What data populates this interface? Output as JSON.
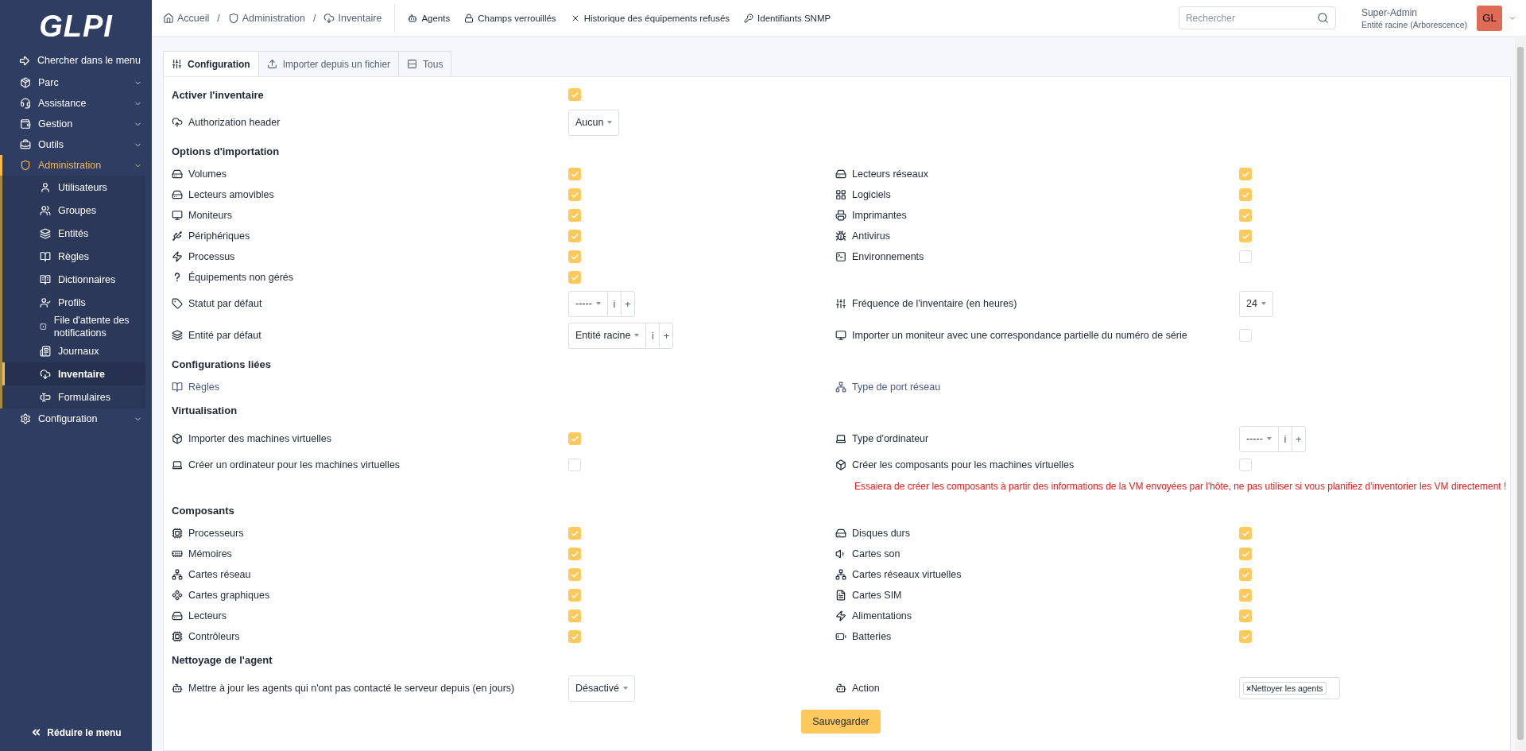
{
  "sidebar": {
    "logo": "GLPI",
    "search": "Chercher dans le menu",
    "items": [
      {
        "label": "Parc",
        "selected": false,
        "expanded": false
      },
      {
        "label": "Assistance",
        "selected": false,
        "expanded": false
      },
      {
        "label": "Gestion",
        "selected": false,
        "expanded": false
      },
      {
        "label": "Outils",
        "selected": false,
        "expanded": false
      },
      {
        "label": "Administration",
        "selected": true,
        "expanded": true,
        "children": [
          {
            "label": "Utilisateurs",
            "selected": false
          },
          {
            "label": "Groupes",
            "selected": false
          },
          {
            "label": "Entités",
            "selected": false
          },
          {
            "label": "Règles",
            "selected": false
          },
          {
            "label": "Dictionnaires",
            "selected": false
          },
          {
            "label": "Profils",
            "selected": false
          },
          {
            "label": "File d'attente des notifications",
            "selected": false
          },
          {
            "label": "Journaux",
            "selected": false
          },
          {
            "label": "Inventaire",
            "selected": true
          },
          {
            "label": "Formulaires",
            "selected": false
          }
        ]
      },
      {
        "label": "Configuration",
        "selected": false,
        "expanded": false
      }
    ],
    "collapse": "Réduire le menu"
  },
  "topbar": {
    "breadcrumbs": [
      "Accueil",
      "Administration",
      "Inventaire"
    ],
    "separator": "/",
    "actions": [
      "Agents",
      "Champs verrouillés",
      "Historique des équipements refusés",
      "Identifiants SNMP"
    ],
    "search": {
      "placeholder": "Rechercher"
    },
    "user": {
      "name": "Super-Admin",
      "entity": "Entité racine (Arborescence)",
      "initials": "GL"
    }
  },
  "tabs": [
    {
      "label": "Configuration",
      "selected": true
    },
    {
      "label": "Importer depuis un fichier",
      "selected": false
    },
    {
      "label": "Tous",
      "selected": false
    }
  ],
  "sections": [
    {
      "title": "Activer l'inventaire",
      "checked": true,
      "rows": [
        {
          "left": {
            "kind": "select",
            "label": "Authorization header",
            "value": "Aucun"
          }
        }
      ]
    },
    {
      "title": "Options d'importation",
      "rows": [
        {
          "left": {
            "kind": "checkbox",
            "label": "Volumes",
            "checked": true
          },
          "right": {
            "kind": "checkbox",
            "label": "Lecteurs réseaux",
            "checked": true
          }
        },
        {
          "left": {
            "kind": "checkbox",
            "label": "Lecteurs amovibles",
            "checked": true
          },
          "right": {
            "kind": "checkbox",
            "label": "Logiciels",
            "checked": true
          }
        },
        {
          "left": {
            "kind": "checkbox",
            "label": "Moniteurs",
            "checked": true
          },
          "right": {
            "kind": "checkbox",
            "label": "Imprimantes",
            "checked": true
          }
        },
        {
          "left": {
            "kind": "checkbox",
            "label": "Périphériques",
            "checked": true
          },
          "right": {
            "kind": "checkbox",
            "label": "Antivirus",
            "checked": true
          }
        },
        {
          "left": {
            "kind": "checkbox",
            "label": "Processus",
            "checked": true
          },
          "right": {
            "kind": "checkbox",
            "label": "Environnements",
            "checked": false
          }
        },
        {
          "left": {
            "kind": "checkbox",
            "label": "Équipements non gérés",
            "checked": true
          }
        },
        {
          "left": {
            "kind": "select",
            "label": "Statut par défaut",
            "value": "-----",
            "buttons": [
              "i",
              "+"
            ]
          },
          "right": {
            "kind": "select",
            "label": "Fréquence de l'inventaire (en heures)",
            "value": "24"
          }
        },
        {
          "left": {
            "kind": "select",
            "label": "Entité par défaut",
            "value": "Entité racine",
            "buttons": [
              "i",
              "+"
            ]
          },
          "right": {
            "kind": "checkbox",
            "label": "Importer un moniteur avec une correspondance partielle du numéro de série",
            "checked": false
          }
        }
      ]
    },
    {
      "title": "Configurations liées",
      "rows": [
        {
          "left": {
            "kind": "link",
            "label": "Règles"
          },
          "right": {
            "kind": "link",
            "label": "Type de port réseau"
          }
        }
      ]
    },
    {
      "title": "Virtualisation",
      "rows": [
        {
          "left": {
            "kind": "checkbox",
            "label": "Importer des machines virtuelles",
            "checked": true
          },
          "right": {
            "kind": "select",
            "label": "Type d'ordinateur",
            "value": "-----",
            "buttons": [
              "i",
              "+"
            ]
          }
        },
        {
          "left": {
            "kind": "checkbox",
            "label": "Créer un ordinateur pour les machines virtuelles",
            "checked": false
          },
          "right": {
            "kind": "checkbox",
            "label": "Créer les composants pour les machines virtuelles",
            "checked": false
          }
        },
        {
          "right": {
            "kind": "note",
            "label": "Essaiera de créer les composants à partir des informations de la VM envoyées par l'hôte, ne pas utiliser si vous planifiez d'inventorier les VM directement !"
          }
        }
      ]
    },
    {
      "title": "Composants",
      "rows": [
        {
          "left": {
            "kind": "checkbox",
            "label": "Processeurs",
            "checked": true
          },
          "right": {
            "kind": "checkbox",
            "label": "Disques durs",
            "checked": true
          }
        },
        {
          "left": {
            "kind": "checkbox",
            "label": "Mémoires",
            "checked": true
          },
          "right": {
            "kind": "checkbox",
            "label": "Cartes son",
            "checked": true
          }
        },
        {
          "left": {
            "kind": "checkbox",
            "label": "Cartes réseau",
            "checked": true
          },
          "right": {
            "kind": "checkbox",
            "label": "Cartes réseaux virtuelles",
            "checked": true
          }
        },
        {
          "left": {
            "kind": "checkbox",
            "label": "Cartes graphiques",
            "checked": true
          },
          "right": {
            "kind": "checkbox",
            "label": "Cartes SIM",
            "checked": true
          }
        },
        {
          "left": {
            "kind": "checkbox",
            "label": "Lecteurs",
            "checked": true
          },
          "right": {
            "kind": "checkbox",
            "label": "Alimentations",
            "checked": true
          }
        },
        {
          "left": {
            "kind": "checkbox",
            "label": "Contrôleurs",
            "checked": true
          },
          "right": {
            "kind": "checkbox",
            "label": "Batteries",
            "checked": true
          }
        }
      ]
    },
    {
      "title": "Nettoyage de l'agent",
      "rows": [
        {
          "left": {
            "kind": "select",
            "label": "Mettre à jour les agents qui n'ont pas contacté le serveur depuis (en jours)",
            "value": "Désactivé"
          },
          "right": {
            "kind": "tags",
            "label": "Action",
            "tags": [
              {
                "label": "Nettoyer les agents",
                "remove": "×"
              }
            ]
          }
        }
      ]
    }
  ],
  "save": "Sauvegarder"
}
